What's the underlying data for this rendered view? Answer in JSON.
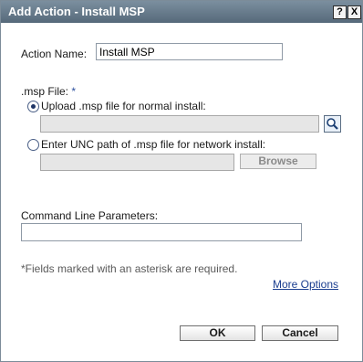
{
  "window": {
    "title": "Add Action - Install MSP",
    "help_label": "?",
    "close_label": "X"
  },
  "form": {
    "action_name_label": "Action Name:",
    "action_name_value": "Install MSP",
    "msp_file_label": ".msp File:",
    "required_marker": "*",
    "upload_option_label": "Upload .msp file for normal install:",
    "upload_path_value": "",
    "unc_option_label": "Enter UNC path of .msp file for network install:",
    "unc_path_value": "",
    "browse_label": "Browse",
    "cmd_params_label": "Command Line Parameters:",
    "cmd_params_value": "",
    "required_note": "*Fields marked with an asterisk are required.",
    "more_options_label": "More Options"
  },
  "buttons": {
    "ok_label": "OK",
    "cancel_label": "Cancel"
  },
  "selection": {
    "selected_source": "upload"
  },
  "icons": {
    "search": "magnifier-icon",
    "help": "help-icon",
    "close": "close-icon"
  },
  "colors": {
    "titlebar": "#56697a",
    "link": "#1a3d8f",
    "required_marker": "#2c4f9e"
  }
}
